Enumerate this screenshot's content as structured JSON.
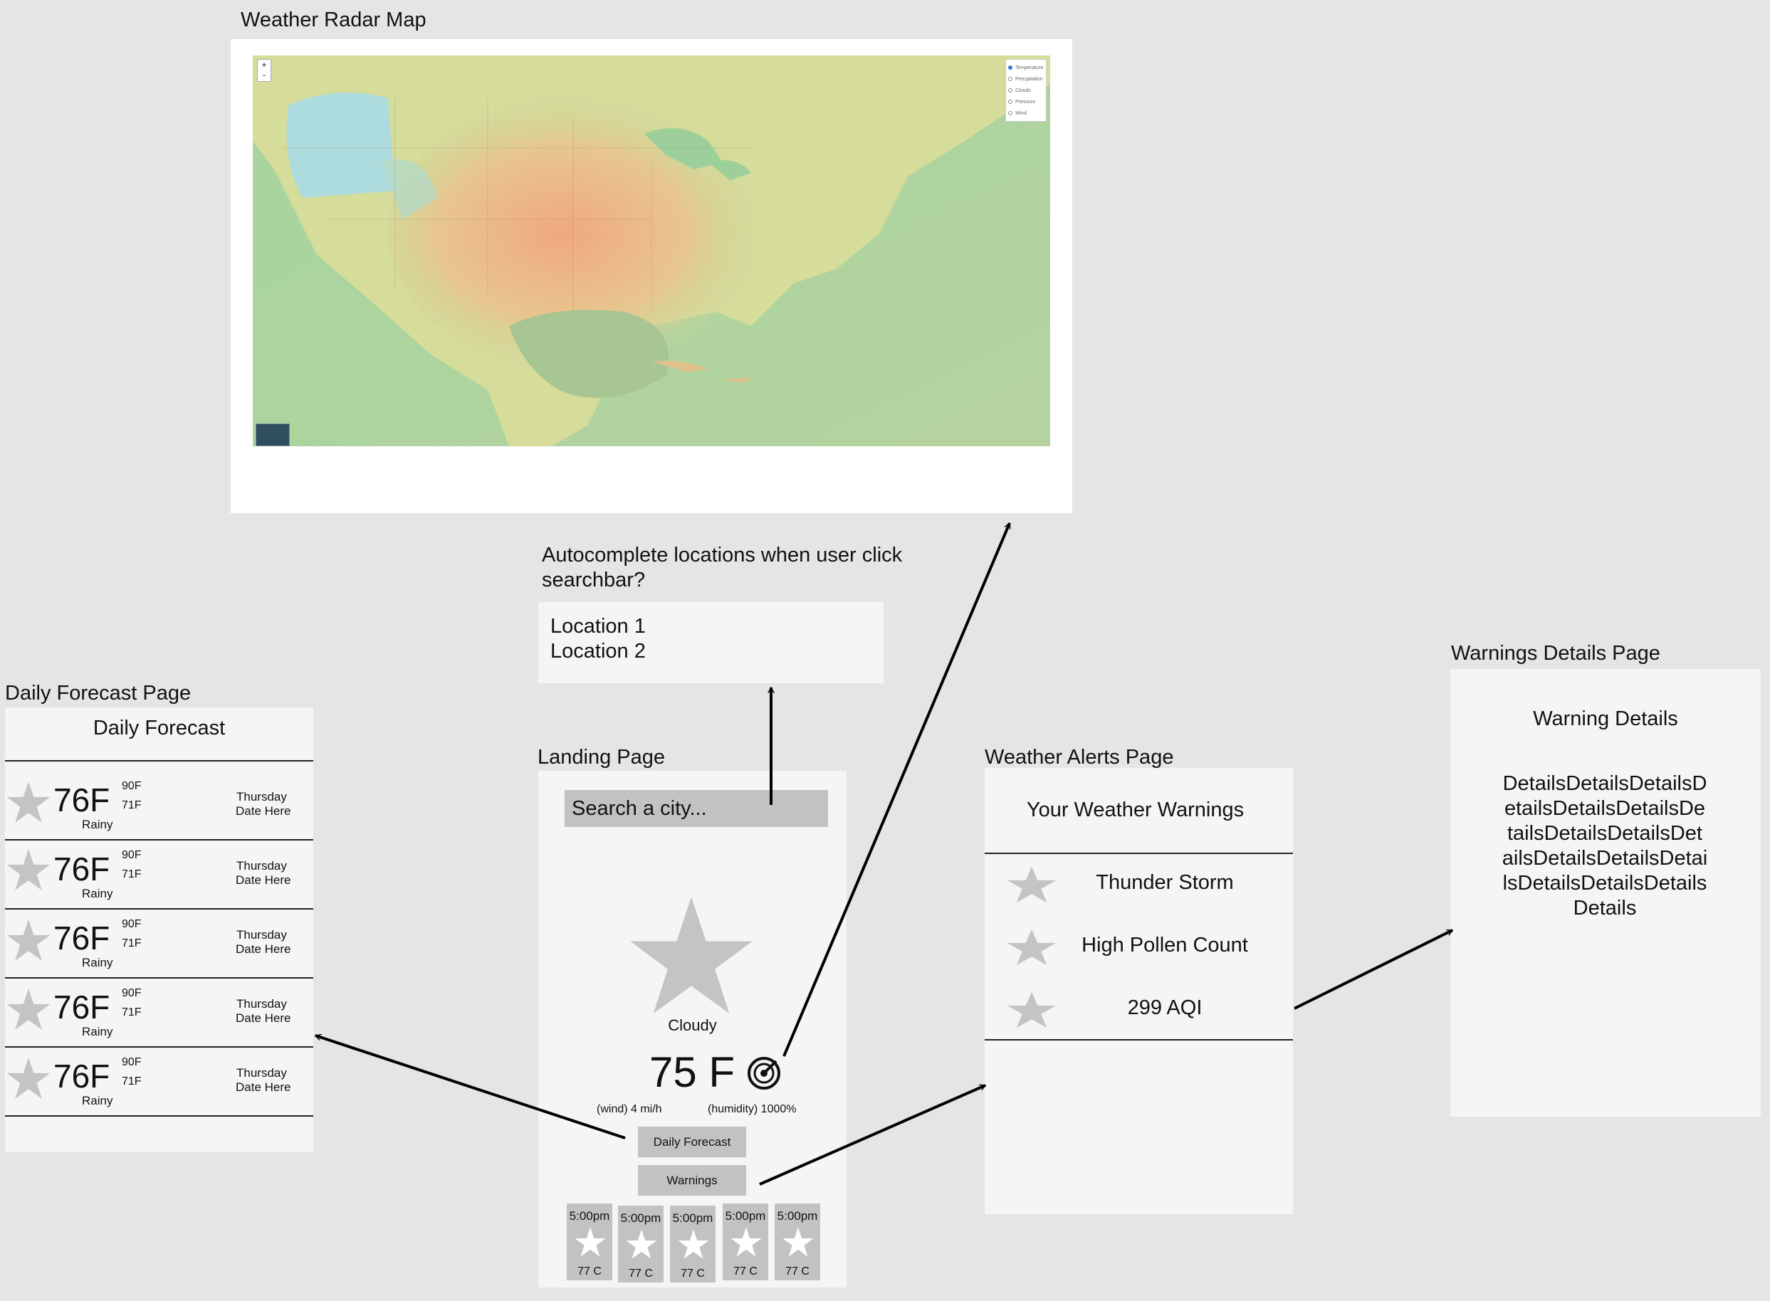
{
  "radar": {
    "label": "Weather Radar Map",
    "zoom_in": "+",
    "zoom_out": "-",
    "layers": [
      "Temperature",
      "Precipitation",
      "Clouds",
      "Pressure",
      "Wind"
    ],
    "selected_layer": "Temperature"
  },
  "autocomplete": {
    "question": "Autocomplete locations when user click searchbar?",
    "locations": [
      "Location 1",
      "Location 2"
    ]
  },
  "landing": {
    "label": "Landing Page",
    "search_placeholder": "Search a city...",
    "condition": "Cloudy",
    "temperature": "75 F",
    "wind": "(wind) 4 mi/h",
    "humidity": "(humidity) 1000%",
    "daily_button": "Daily Forecast",
    "warnings_button": "Warnings",
    "hourly": [
      {
        "time": "5:00pm",
        "temp": "77 C"
      },
      {
        "time": "5:00pm",
        "temp": "77 C"
      },
      {
        "time": "5:00pm",
        "temp": "77 C"
      },
      {
        "time": "5:00pm",
        "temp": "77 C"
      },
      {
        "time": "5:00pm",
        "temp": "77 C"
      }
    ]
  },
  "daily": {
    "label": "Daily Forecast Page",
    "title": "Daily Forecast",
    "days": [
      {
        "temp": "76F",
        "high": "90F",
        "low": "71F",
        "condition": "Rainy",
        "day": "Thursday",
        "date": "Date Here"
      },
      {
        "temp": "76F",
        "high": "90F",
        "low": "71F",
        "condition": "Rainy",
        "day": "Thursday",
        "date": "Date Here"
      },
      {
        "temp": "76F",
        "high": "90F",
        "low": "71F",
        "condition": "Rainy",
        "day": "Thursday",
        "date": "Date Here"
      },
      {
        "temp": "76F",
        "high": "90F",
        "low": "71F",
        "condition": "Rainy",
        "day": "Thursday",
        "date": "Date Here"
      },
      {
        "temp": "76F",
        "high": "90F",
        "low": "71F",
        "condition": "Rainy",
        "day": "Thursday",
        "date": "Date Here"
      }
    ]
  },
  "alerts": {
    "label": "Weather Alerts Page",
    "title": "Your Weather Warnings",
    "items": [
      "Thunder Storm",
      "High Pollen Count",
      "299 AQI"
    ]
  },
  "details": {
    "label": "Warnings Details Page",
    "title": "Warning Details",
    "body": "DetailsDetailsDetailsDetailsDetailsDetailsDetailsDetailsDetailsDetailsDetailsDetailsDetailsDetailsDetailsDetailsDetails"
  },
  "colors": {
    "background": "#e5e5e5",
    "panel": "#f5f5f5",
    "placeholder_gray": "#c2c2c2",
    "star_gray": "#c4c4c4"
  }
}
